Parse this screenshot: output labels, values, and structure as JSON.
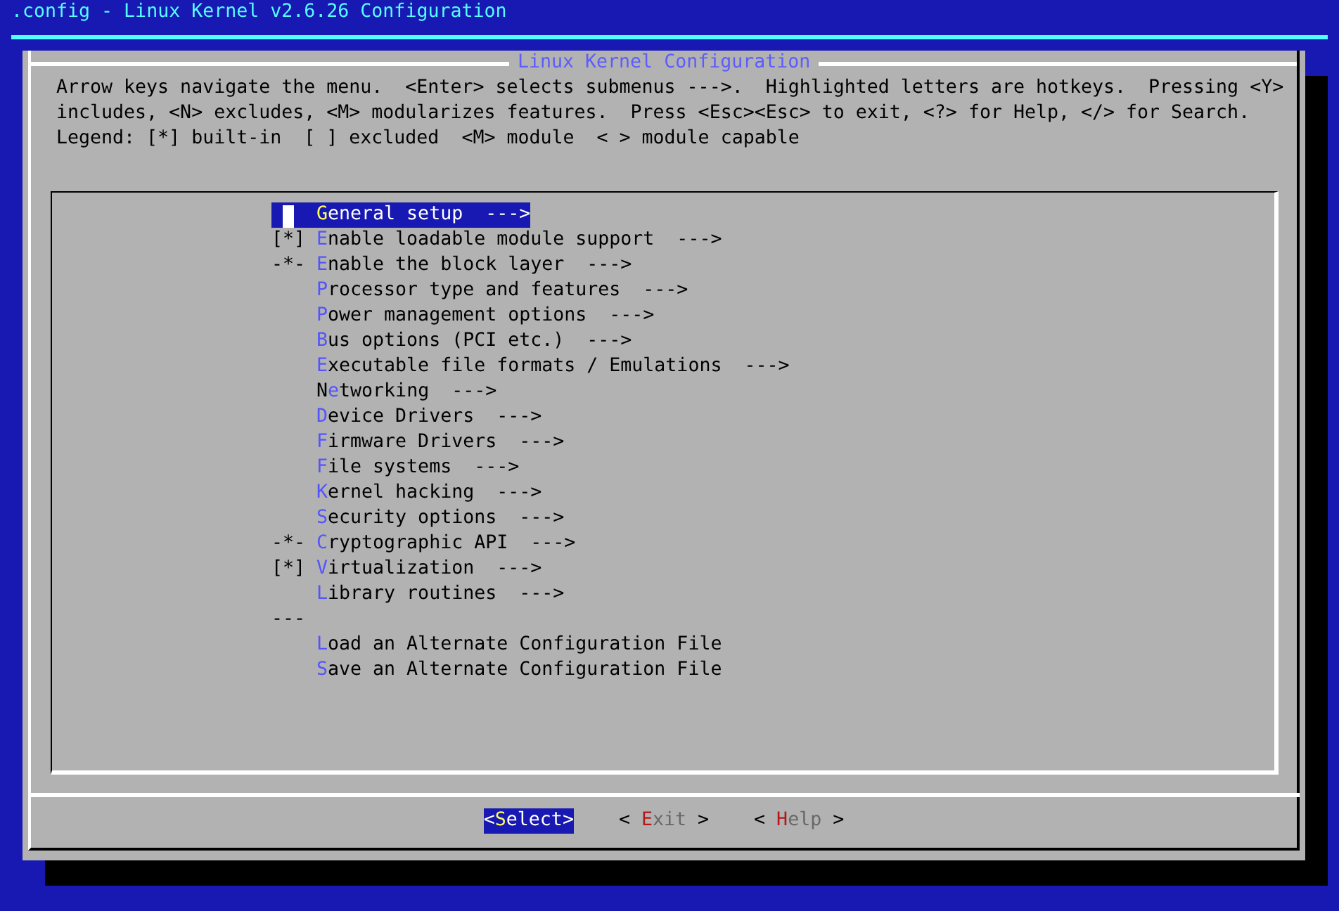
{
  "screen_title": ".config - Linux Kernel v2.6.26 Configuration",
  "dialog": {
    "title": "Linux Kernel Configuration",
    "help_lines": [
      "Arrow keys navigate the menu.  <Enter> selects submenus --->.  Highlighted letters are hotkeys.  Pressing <Y>",
      "includes, <N> excludes, <M> modularizes features.  Press <Esc><Esc> to exit, <?> for Help, </> for Search.",
      "Legend: [*] built-in  [ ] excluded  <M> module  < > module capable"
    ],
    "menu": [
      {
        "kind": "entry",
        "label": "**G**eneral setup  --->",
        "selected": true
      },
      {
        "kind": "entry",
        "prefix": "[*]",
        "label": "**E**nable loadable module support  --->",
        "selected": false
      },
      {
        "kind": "entry",
        "prefix": "-*-",
        "label": "**E**nable the block layer  --->",
        "selected": false
      },
      {
        "kind": "entry",
        "label": "**P**rocessor type and features  --->",
        "selected": false
      },
      {
        "kind": "entry",
        "label": "**P**ower management options  --->",
        "selected": false
      },
      {
        "kind": "entry",
        "label": "**B**us options (PCI etc.)  --->",
        "selected": false
      },
      {
        "kind": "entry",
        "label": "**E**xecutable file formats / Emulations  --->",
        "selected": false
      },
      {
        "kind": "entry",
        "label": "N**e**tworking  --->",
        "selected": false
      },
      {
        "kind": "entry",
        "label": "**D**evice Drivers  --->",
        "selected": false
      },
      {
        "kind": "entry",
        "label": "**F**irmware Drivers  --->",
        "selected": false
      },
      {
        "kind": "entry",
        "label": "**F**ile systems  --->",
        "selected": false
      },
      {
        "kind": "entry",
        "label": "**K**ernel hacking  --->",
        "selected": false
      },
      {
        "kind": "entry",
        "label": "**S**ecurity options  --->",
        "selected": false
      },
      {
        "kind": "entry",
        "prefix": "-*-",
        "label": "**C**ryptographic API  --->",
        "selected": false
      },
      {
        "kind": "entry",
        "prefix": "[*]",
        "label": "**V**irtualization  --->",
        "selected": false
      },
      {
        "kind": "entry",
        "label": "**L**ibrary routines  --->",
        "selected": false
      },
      {
        "kind": "separator",
        "text": "---"
      },
      {
        "kind": "entry",
        "label": "**L**oad an Alternate Configuration File",
        "selected": false
      },
      {
        "kind": "entry",
        "label": "**S**ave an Alternate Configuration File",
        "selected": false
      }
    ],
    "buttons": [
      {
        "open": "<",
        "label": "**S**elect",
        "close": ">",
        "selected": true
      },
      {
        "open": "< ",
        "label": "**E**xit",
        "close": " >",
        "selected": false
      },
      {
        "open": "< ",
        "label": "**H**elp",
        "close": " >",
        "selected": false
      }
    ]
  }
}
